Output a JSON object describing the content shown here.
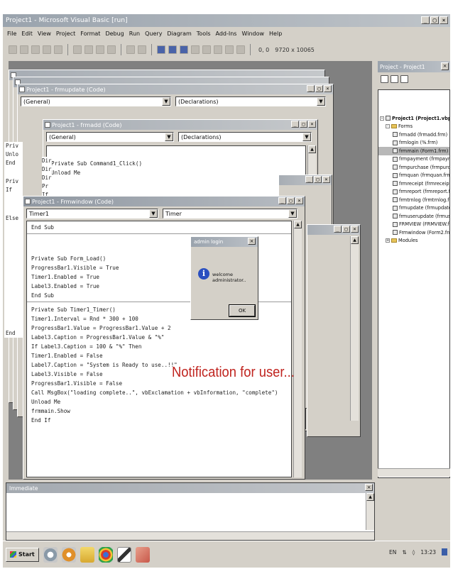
{
  "window": {
    "title": "Project1 - Microsoft Visual Basic [run]",
    "controls": [
      "_",
      "▢",
      "×"
    ]
  },
  "menu": [
    "File",
    "Edit",
    "View",
    "Project",
    "Format",
    "Debug",
    "Run",
    "Query",
    "Diagram",
    "Tools",
    "Add-Ins",
    "Window",
    "Help"
  ],
  "toolbar": {
    "position": "0, 0",
    "size": "9720 x 10065"
  },
  "back_windows": [
    {
      "title": "Project1 - frmupdate (Code)",
      "obj_combo": "(General)",
      "proc_combo": "(Declarations)"
    },
    {
      "title": "Project1 - frmadd (Code)",
      "obj_combo": "(General)",
      "proc_combo": "(Declarations)"
    }
  ],
  "frmadd_code": [
    "Private Sub Command1_Click()",
    "Unload Me"
  ],
  "left_fragments": [
    "Priv",
    "Unlo",
    "End",
    "Priv",
    "If",
    "Else",
    "End",
    "Dir",
    "Dir",
    "Dir",
    "Pr",
    "If"
  ],
  "front_window": {
    "title": "Project1 - Frmwindow (Code)",
    "obj_combo": "Timer1",
    "proc_combo": "Timer",
    "blocks": [
      [
        "End Sub"
      ],
      [
        "Private Sub Form_Load()",
        "ProgressBar1.Visible = True",
        "Timer1.Enabled = True",
        "Label3.Enabled = True",
        "End Sub"
      ],
      [
        "Private Sub Timer1_Timer()",
        "Timer1.Interval = Rnd * 300 + 100",
        "ProgressBar1.Value = ProgressBar1.Value + 2",
        "Label3.Caption = ProgressBar1.Value & \"%\"",
        "If Label3.Caption = 100 & \"%\" Then",
        "Timer1.Enabled = False",
        "Label7.Caption = \"System is Ready to use..!!\"",
        "Label3.Visible = False",
        "ProgressBar1.Visible = False",
        "Call MsgBox(\"loading complete..\", vbExclamation + vbInformation, \"complete\")",
        "Unload Me",
        "frmmain.Show",
        "End If"
      ]
    ]
  },
  "dialog": {
    "title": "admin login",
    "message": "welcome administrator..",
    "ok": "OK"
  },
  "annotation": "Notification for user...",
  "project_panel": {
    "title": "Project - Project1",
    "root": "Project1 (Project1.vbp)",
    "forms_folder": "Forms",
    "forms": [
      "frmadd (frmadd.frm)",
      "frmlogin (%.frm)",
      "frmmain (Form1.frm)",
      "frmpayment (frmpayme",
      "frmpurchase (frmpurch",
      "frmquan (frmquan.frm)",
      "frmreceipt (frmreceipt.f",
      "frmreport (frmreport.fr",
      "frmtrnlog (frmtrnlog.frm",
      "frmupdate (frmupdate.",
      "frmuserupdate (frmuse",
      "FRMVIEW (FRMVIEW.fr",
      "Frmwindow (Form2.frm"
    ],
    "selected_index": 2,
    "modules_folder": "Modules"
  },
  "immediate": {
    "title": "Immediate"
  },
  "taskbar": {
    "start": "Start",
    "tray_lang": "EN",
    "clock": "13:23"
  }
}
